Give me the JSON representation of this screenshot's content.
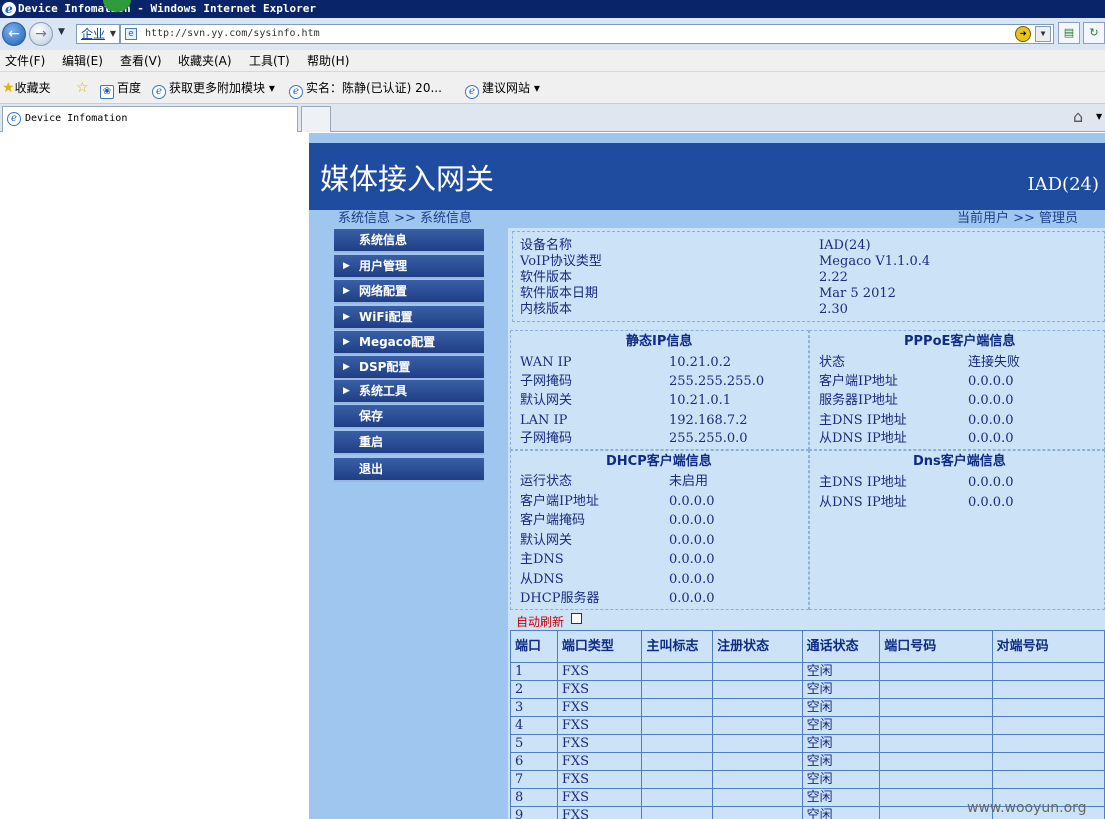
{
  "window": {
    "title": "Device Infomation - Windows Internet Explorer"
  },
  "browser": {
    "zone": "企业",
    "url": "http://svn.yy.com/sysinfo.htm",
    "menu": [
      "文件(F)",
      "编辑(E)",
      "查看(V)",
      "收藏夹(A)",
      "工具(T)",
      "帮助(H)"
    ],
    "favorites_label": "收藏夹",
    "favorites": [
      "百度",
      "获取更多附加模块 ▾",
      "实名：陈静(已认证) 20...",
      "建议网站 ▾"
    ],
    "tab_title": "Device Infomation"
  },
  "page": {
    "title": "媒体接入网关",
    "device_tag": "IAD(24)",
    "breadcrumb": "系统信息 >> 系统信息",
    "user": "当前用户 >> 管理员"
  },
  "nav": [
    {
      "label": "系统信息",
      "arrow": false
    },
    {
      "label": "用户管理",
      "arrow": true
    },
    {
      "label": "网络配置",
      "arrow": true
    },
    {
      "label": "WiFi配置",
      "arrow": true
    },
    {
      "label": "Megaco配置",
      "arrow": true
    },
    {
      "label": "DSP配置",
      "arrow": true
    },
    {
      "label": "系统工具",
      "arrow": true
    },
    {
      "label": "保存",
      "arrow": false
    },
    {
      "label": "重启",
      "arrow": false
    },
    {
      "label": "退出",
      "arrow": false
    }
  ],
  "device": {
    "labels": [
      "设备名称",
      "VoIP协议类型",
      "软件版本",
      "软件版本日期",
      "内核版本"
    ],
    "values": [
      "IAD(24)",
      "Megaco V1.1.0.4",
      "2.22",
      "Mar 5 2012",
      "2.30"
    ]
  },
  "static_ip": {
    "title": "静态IP信息",
    "labels": [
      "WAN IP",
      "子网掩码",
      "默认网关",
      "LAN IP",
      "子网掩码"
    ],
    "values": [
      "10.21.0.2",
      "255.255.255.0",
      "10.21.0.1",
      "192.168.7.2",
      "255.255.0.0"
    ]
  },
  "pppoe": {
    "title": "PPPoE客户端信息",
    "labels": [
      "状态",
      "客户端IP地址",
      "服务器IP地址",
      "主DNS IP地址",
      "从DNS IP地址"
    ],
    "values": [
      "连接失败",
      "0.0.0.0",
      "0.0.0.0",
      "0.0.0.0",
      "0.0.0.0"
    ]
  },
  "dhcp": {
    "title": "DHCP客户端信息",
    "labels": [
      "运行状态",
      "客户端IP地址",
      "客户端掩码",
      "默认网关",
      "主DNS",
      "从DNS",
      "DHCP服务器"
    ],
    "values": [
      "未启用",
      "0.0.0.0",
      "0.0.0.0",
      "0.0.0.0",
      "0.0.0.0",
      "0.0.0.0",
      "0.0.0.0"
    ]
  },
  "dns": {
    "title": "Dns客户端信息",
    "labels": [
      "主DNS IP地址",
      "从DNS IP地址"
    ],
    "values": [
      "0.0.0.0",
      "0.0.0.0"
    ]
  },
  "ports": {
    "auto_refresh": "自动刷新",
    "headers": [
      "端口",
      "端口类型",
      "主叫标志",
      "注册状态",
      "通话状态",
      "端口号码",
      "对端号码"
    ],
    "rows": [
      [
        "1",
        "FXS",
        "",
        "",
        "空闲",
        "",
        ""
      ],
      [
        "2",
        "FXS",
        "",
        "",
        "空闲",
        "",
        ""
      ],
      [
        "3",
        "FXS",
        "",
        "",
        "空闲",
        "",
        ""
      ],
      [
        "4",
        "FXS",
        "",
        "",
        "空闲",
        "",
        ""
      ],
      [
        "5",
        "FXS",
        "",
        "",
        "空闲",
        "",
        ""
      ],
      [
        "6",
        "FXS",
        "",
        "",
        "空闲",
        "",
        ""
      ],
      [
        "7",
        "FXS",
        "",
        "",
        "空闲",
        "",
        ""
      ],
      [
        "8",
        "FXS",
        "",
        "",
        "空闲",
        "",
        ""
      ],
      [
        "9",
        "FXS",
        "",
        "",
        "空闲",
        "",
        ""
      ]
    ]
  },
  "watermark": "www.wooyun.org"
}
